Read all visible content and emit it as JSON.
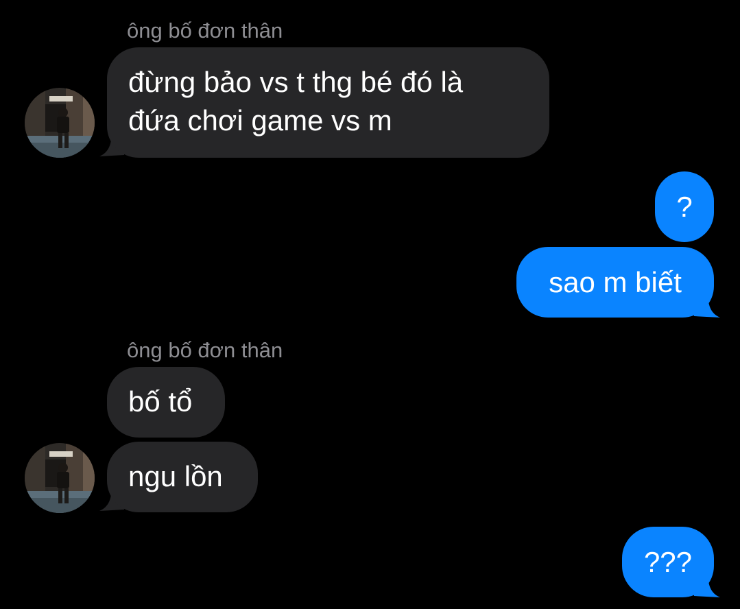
{
  "thread": {
    "messages": [
      {
        "id": "m1",
        "direction": "incoming",
        "sender": "ông bố đơn thân",
        "lines": [
          "đừng bảo vs t thg bé đó là",
          "đứa chơi game vs m"
        ]
      },
      {
        "id": "m2",
        "direction": "outgoing",
        "text": "?"
      },
      {
        "id": "m3",
        "direction": "outgoing",
        "text": "sao m biết"
      },
      {
        "id": "m4",
        "direction": "incoming",
        "sender": "ông bố đơn thân",
        "text": "bố tổ"
      },
      {
        "id": "m5",
        "direction": "incoming",
        "text": "ngu lồn"
      },
      {
        "id": "m6",
        "direction": "outgoing",
        "text": "???"
      }
    ]
  },
  "colors": {
    "background": "#000000",
    "incoming_bubble": "#262628",
    "outgoing_bubble": "#0a84ff",
    "sender_name": "#8e8e93",
    "text": "#ffffff"
  },
  "icons": {
    "avatar": "contact-avatar-photo"
  }
}
